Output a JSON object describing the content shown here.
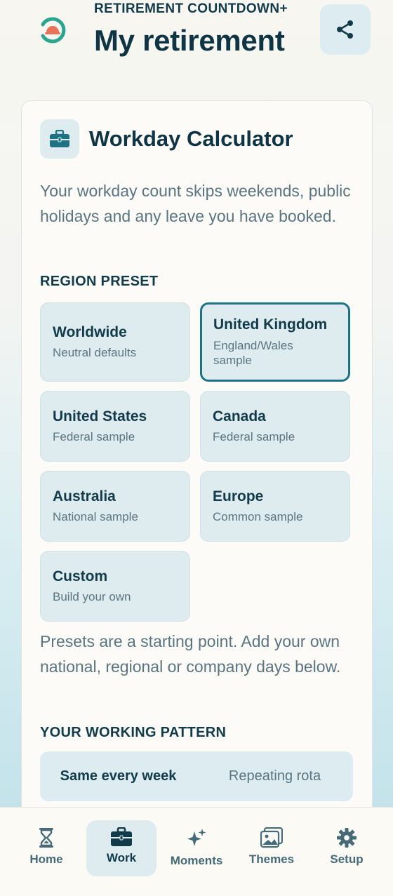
{
  "header": {
    "eyebrow": "RETIREMENT COUNTDOWN+",
    "title": "My retirement",
    "logo_icon": "sunset-ring-logo",
    "share_icon": "share-icon"
  },
  "card": {
    "icon": "briefcase-icon",
    "title": "Workday Calculator",
    "description": "Your workday count skips weekends, public holidays and any leave you have booked.",
    "region_label": "REGION PRESET",
    "presets": [
      {
        "name": "Worldwide",
        "desc": "Neutral defaults",
        "selected": false
      },
      {
        "name": "United Kingdom",
        "desc": "England/Wales sample",
        "selected": true
      },
      {
        "name": "United States",
        "desc": "Federal sample",
        "selected": false
      },
      {
        "name": "Canada",
        "desc": "Federal sample",
        "selected": false
      },
      {
        "name": "Australia",
        "desc": "National sample",
        "selected": false
      },
      {
        "name": "Europe",
        "desc": "Common sample",
        "selected": false
      },
      {
        "name": "Custom",
        "desc": "Build your own",
        "selected": false
      }
    ],
    "note": "Presets are a starting point. Add your own national, regional or company days below.",
    "pattern_label": "YOUR WORKING PATTERN",
    "pattern_options": [
      {
        "label": "Same every week",
        "active": true
      },
      {
        "label": "Repeating rota",
        "active": false
      }
    ]
  },
  "nav": {
    "items": [
      {
        "label": "Home",
        "icon": "hourglass-icon",
        "active": false
      },
      {
        "label": "Work",
        "icon": "briefcase-icon",
        "active": true
      },
      {
        "label": "Moments",
        "icon": "sparkles-icon",
        "active": false
      },
      {
        "label": "Themes",
        "icon": "image-icon",
        "active": false
      },
      {
        "label": "Setup",
        "icon": "gear-icon",
        "active": false
      }
    ]
  },
  "colors": {
    "accent": "#1d7384",
    "logo_ring": "#2ba58e",
    "logo_sun": "#e8735a",
    "text_dark": "#0f3443",
    "text_muted": "#5b7580",
    "chip_bg": "#deecf0"
  }
}
